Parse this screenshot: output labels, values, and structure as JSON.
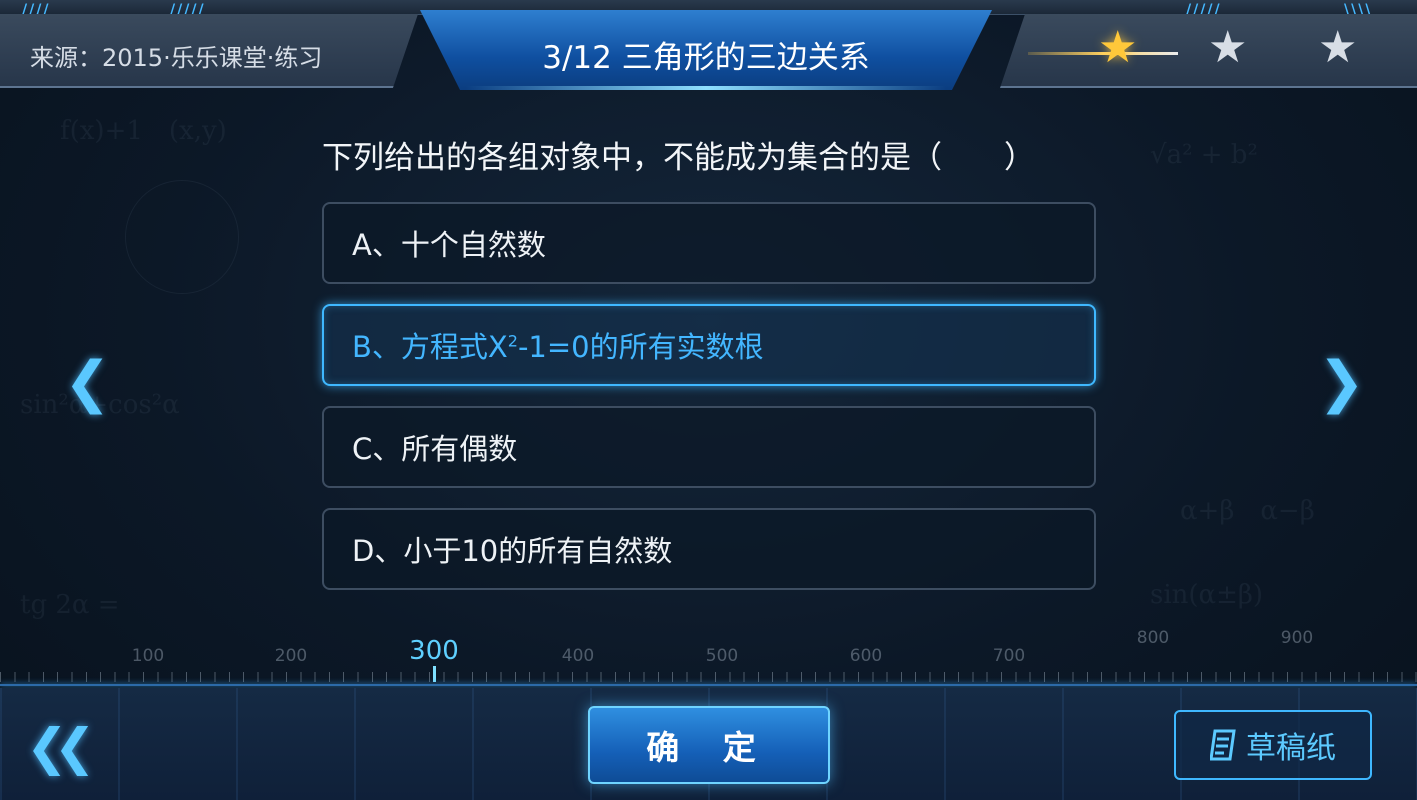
{
  "header": {
    "source_label": "来源：2015·乐乐课堂·练习",
    "title": "3/12 三角形的三边关系",
    "stars": {
      "earned": 1,
      "total": 3
    }
  },
  "question": {
    "text": "下列给出的各组对象中，不能成为集合的是（　　）",
    "options": [
      {
        "label": "A、十个自然数",
        "selected": false
      },
      {
        "label_pre": "B、方程式X",
        "label_sup": "2",
        "label_post": "-1=0的所有实数根",
        "selected": true
      },
      {
        "label": "C、所有偶数",
        "selected": false
      },
      {
        "label": "D、小于10的所有自然数",
        "selected": false
      }
    ]
  },
  "ruler": {
    "labels": [
      "100",
      "200",
      "300",
      "400",
      "500",
      "600",
      "700",
      "800",
      "900"
    ],
    "current": "300"
  },
  "footer": {
    "confirm_label": "确 定",
    "draft_label": "草稿纸"
  },
  "icons": {
    "prev": "chevron-left-icon",
    "next": "chevron-right-icon",
    "back": "double-chevron-left-icon",
    "draft": "notepad-icon",
    "star": "star-icon"
  },
  "colors": {
    "accent": "#3fb8ff",
    "star_gold": "#ffc83a",
    "title_blue": "#1560b8"
  }
}
